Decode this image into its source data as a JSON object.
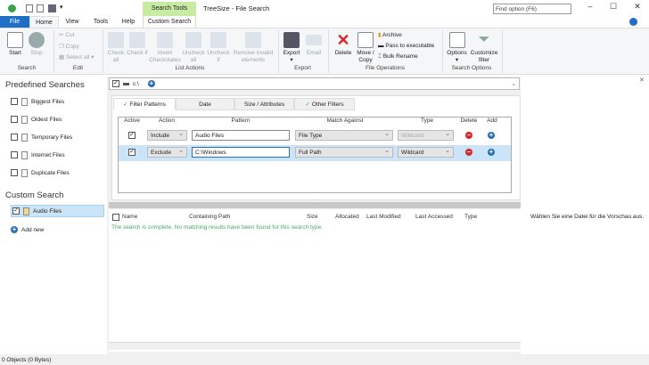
{
  "window": {
    "title": "TreeSize - File Search",
    "find_placeholder": "Find option (F6)",
    "context_header": "Search Tools"
  },
  "tabs": [
    "File",
    "Home",
    "View",
    "Tools",
    "Help",
    "Custom Search"
  ],
  "ribbon": {
    "search": {
      "label": "Search",
      "start": "Start",
      "stop": "Stop"
    },
    "edit": {
      "label": "Edit",
      "cut": "Cut",
      "copy": "Copy",
      "select_all": "Select all"
    },
    "list_actions": {
      "label": "List Actions",
      "items": [
        "Check all",
        "Check if",
        "Invert Checkstates",
        "Uncheck all",
        "Uncheck if",
        "Remove invalid elements"
      ]
    },
    "export": {
      "label": "Export",
      "export": "Export",
      "email": "Email"
    },
    "file_ops": {
      "label": "File Operations",
      "delete": "Delete",
      "move_copy": "Move / Copy",
      "archive": "Archive",
      "pass": "Pass to executable",
      "bulk": "Bulk Rename"
    },
    "search_options": {
      "label": "Search Options",
      "options": "Options",
      "customize": "Customize filter"
    }
  },
  "sidebar": {
    "predefined_title": "Predefined Searches",
    "predefined": [
      "Biggest Files",
      "Oldest Files",
      "Temporary Files",
      "Internet Files",
      "Duplicate Files"
    ],
    "custom_title": "Custom Search",
    "custom": [
      "Audio Files"
    ],
    "add_new": "Add new"
  },
  "path": "c:\\",
  "filter_tabs": [
    "Filter Patterns",
    "Date",
    "Size / Attributes",
    "Other Filters"
  ],
  "grid": {
    "headers": [
      "Active",
      "Action",
      "Pattern",
      "Match Against",
      "Type",
      "Delete",
      "Add"
    ],
    "rows": [
      {
        "active": true,
        "action": "Include",
        "pattern": "Audio Files",
        "match": "File Type",
        "type": "Wildcard",
        "type_disabled": true
      },
      {
        "active": true,
        "action": "Exclude",
        "pattern": "C:\\Windows",
        "match": "Full Path",
        "type": "Wildcard",
        "type_disabled": false
      }
    ]
  },
  "results": {
    "headers": [
      "Name",
      "Containing Path",
      "Size",
      "Allocated",
      "Last Modified",
      "Last Accessed",
      "Type"
    ],
    "message": "The search is complete. No matching results have been found for this search type."
  },
  "preview": "Wählen Sie eine Datei für die Vorschau aus.",
  "status": "0 Objects (0 Bytes)",
  "colors": {
    "accent": "#2a6ebb",
    "context": "#c8eba4",
    "selected_row": "#cce4f7",
    "delete": "#d9262b"
  }
}
